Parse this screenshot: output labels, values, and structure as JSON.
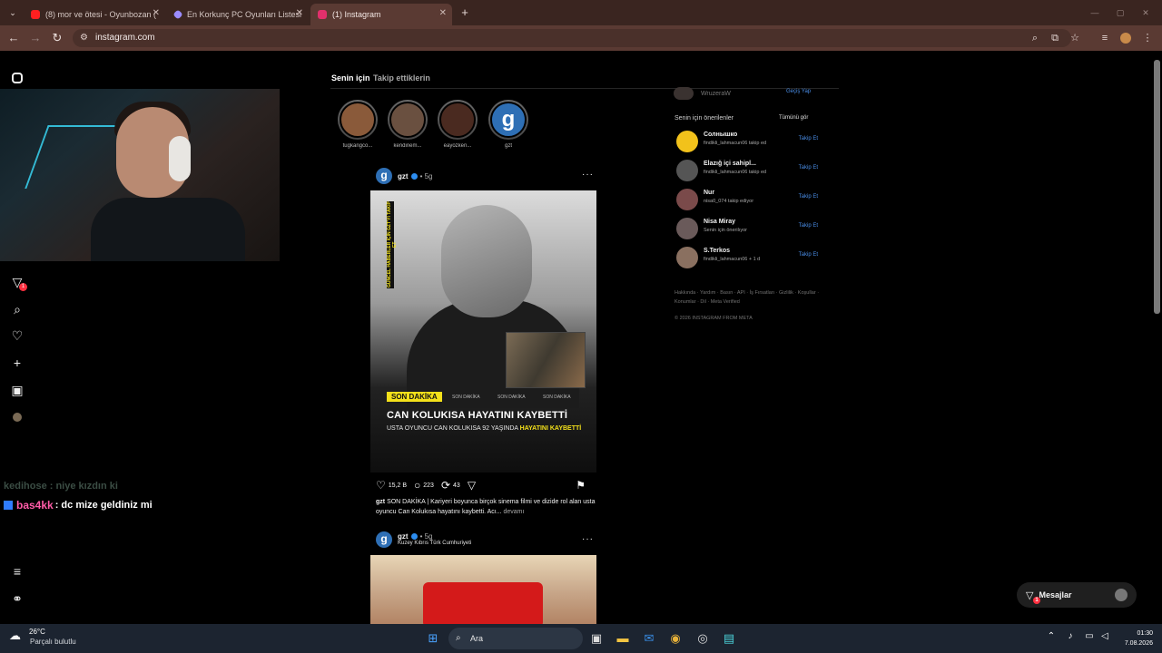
{
  "browser": {
    "tabs": [
      {
        "title": "(8) mor ve ötesi - Oyunbozan (",
        "color": "#ff2020"
      },
      {
        "title": "En Korkunç PC Oyunları Listesi",
        "color": "#9b8cff"
      },
      {
        "title": "(1) Instagram",
        "color": "#e1306c"
      }
    ],
    "url": "instagram.com"
  },
  "chat": {
    "faded": "kedihose : niye kızdın ki",
    "user": "bas4kk",
    "message": ": dc mize geldiniz mi"
  },
  "sidebar": {
    "notification_count": "1"
  },
  "feed": {
    "tabs": [
      "Senin için",
      "Takip ettiklerin"
    ],
    "stories": [
      {
        "name": "tugkangco...",
        "color": "#8a5a3a"
      },
      {
        "name": "kendinem...",
        "color": "#6a5040"
      },
      {
        "name": "eayozken...",
        "color": "#4a2a20"
      },
      {
        "name": "gzt",
        "color": "#2e6fb5"
      }
    ],
    "post1": {
      "avatar_letter": "g",
      "username": "gzt",
      "time": "• 5g",
      "vertical_text": "GÜNCEL HABERLER İÇİN GZT'Yİ TAKİP ET",
      "tag": "SON DAKİKA",
      "mini_tags": [
        "SON DAKİKA",
        "SON DAKİKA",
        "SON DAKİKA"
      ],
      "headline": "CAN KOLUKISA HAYATINI KAYBETTİ",
      "subline_prefix": "USTA OYUNCU CAN KOLUKISA 92 YAŞINDA",
      "subline_highlight": "HAYATINI KAYBETTİ",
      "likes": "15,2 B",
      "comments": "223",
      "reposts": "43",
      "caption_user": "gzt",
      "caption_text": "SON DAKİKA | Kariyeri boyunca birçok sinema filmi ve dizide rol alan usta oyuncu Can Kolukısa hayatını kaybetti. Acı...",
      "caption_more": "devamı"
    },
    "post2": {
      "avatar_letter": "g",
      "username": "gzt",
      "time": "• 5g",
      "location": "Kuzey Kıbrıs Türk Cumhuriyeti"
    }
  },
  "suggestions": {
    "current_user": "WruzeraW",
    "switch_label": "Geçiş Yap",
    "title": "Senin için önerilenler",
    "see_all": "Tümünü gör",
    "follow_label": "Takip Et",
    "items": [
      {
        "name": "Солнышко",
        "sub": "findikli_lahmacun06 takip ed",
        "color": "#f2c21b"
      },
      {
        "name": "Elazığ içi sahipl...",
        "sub": "findikli_lahmacun06 takip ed",
        "color": "#555555"
      },
      {
        "name": "Nur",
        "sub": "nisa0_074 takip ediyor",
        "color": "#7a4a4a"
      },
      {
        "name": "Nisa Miray",
        "sub": "Senin için önerilıyor",
        "color": "#6a5a5a"
      },
      {
        "name": "S.Terkos",
        "sub": "findikli_lahmacun06 + 1 d",
        "color": "#8a7060"
      }
    ],
    "footer": "Hakkında · Yardım · Basın · API · İş Fırsatları · Gizlilik · Koşullar · Konumlar · Dil · Meta Verified",
    "copyright": "© 2026 INSTAGRAM FROM META"
  },
  "messages": {
    "label": "Mesajlar",
    "badge": "1"
  },
  "taskbar": {
    "temperature": "26°C",
    "weather": "Parçalı bulutlu",
    "search_label": "Ara",
    "time": "01:30",
    "date": "7.08.2026"
  }
}
